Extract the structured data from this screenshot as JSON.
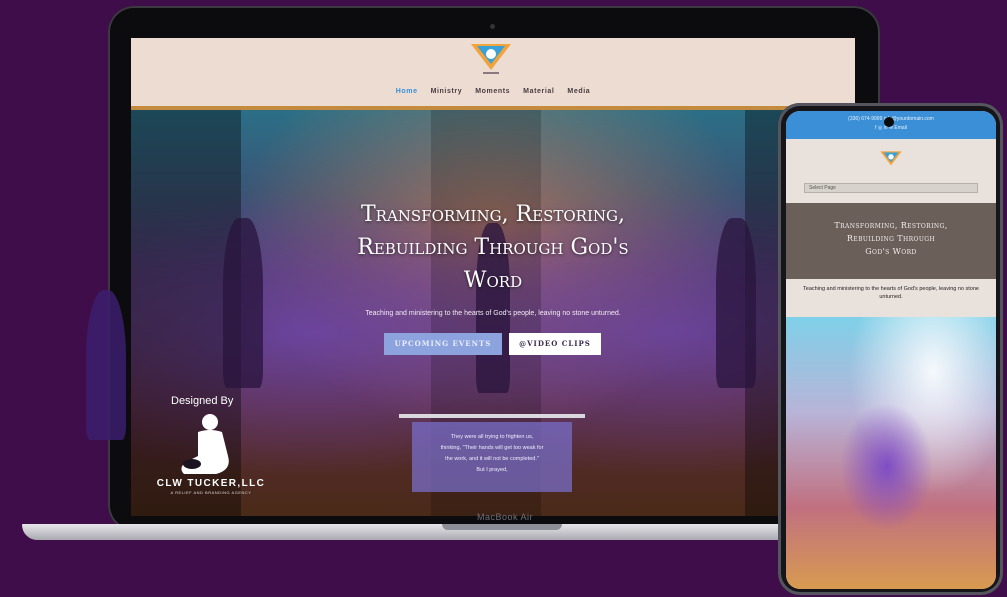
{
  "laptop": {
    "brand_label": "MacBook Air",
    "nav": [
      "Home",
      "Ministry",
      "Moments",
      "Material",
      "Media"
    ],
    "active_nav": "Home",
    "hero": {
      "title_lines": [
        "Transforming, Restoring,",
        "Rebuilding Through God's",
        "Word"
      ],
      "subtitle": "Teaching and ministering to the hearts of God's people, leaving no stone unturned.",
      "btn_events": "UPCOMING EVENTS",
      "btn_video": "@VIDEO CLIPS"
    },
    "quote": {
      "lines": [
        "They were all trying to frighten us,",
        "thinking, \"Their hands will get too weak for",
        "the work, and it will not be completed.\"",
        "But I prayed,"
      ]
    },
    "designer": {
      "designed_by": "Designed By",
      "name": "CLW TUCKER,LLC",
      "tagline": "A RELIEF AND BRANDING AGENCY"
    }
  },
  "phone": {
    "contact": "(336) 674-9999      info@yourdomain.com",
    "social": "f  ◎  in   ✉ Email",
    "select_page": "Select Page",
    "title_lines": [
      "Transforming, Restoring,",
      "Rebuilding Through",
      "God's Word"
    ],
    "subtitle": "Teaching and ministering to the hearts of God's people, leaving no stone unturned."
  },
  "colors": {
    "background": "#3f0d4a",
    "nav_active": "#3a8fd6",
    "header_bg": "#ecdcd2",
    "events_button": "#8da3de"
  }
}
